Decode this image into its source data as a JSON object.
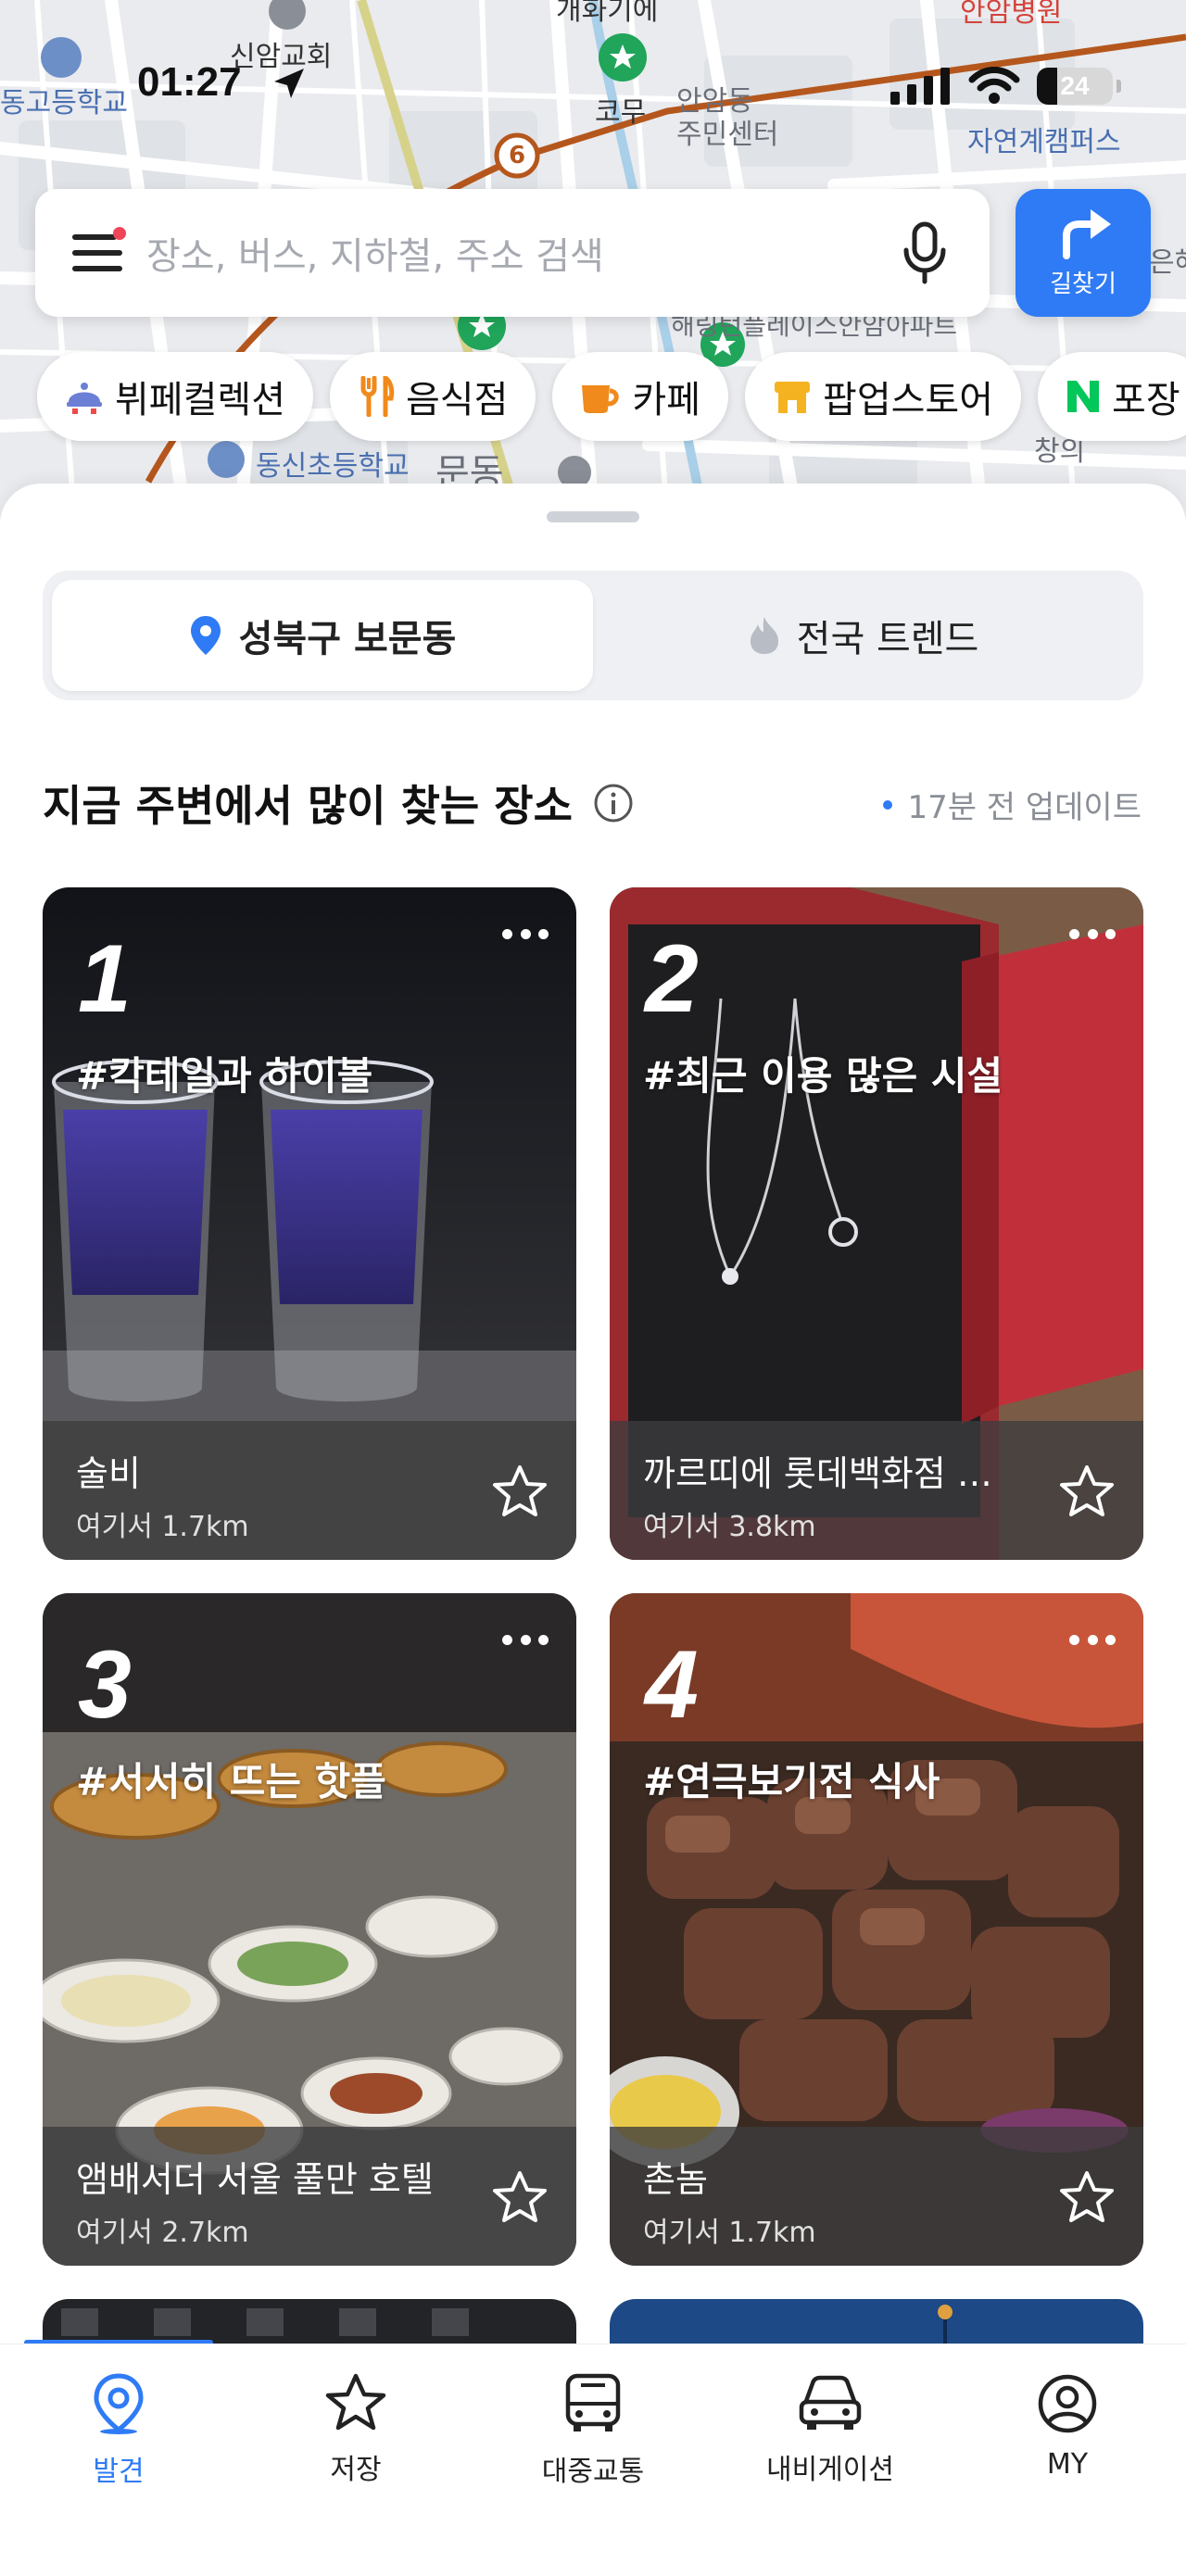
{
  "status_bar": {
    "time": "01:27",
    "battery": "24"
  },
  "map": {
    "labels": {
      "church": "신암교회",
      "school_left": "동고등학교",
      "station_top": "개화기에",
      "komu": "코무",
      "anam_center": "안암동\n주민센터",
      "hospital": "안암병원",
      "campus": "자연계캠퍼스",
      "apartment": "해링턴플레이스안암아파트",
      "elem_school": "동신초등학교",
      "bomun": "문동",
      "changui": "창의",
      "eun": "은해"
    },
    "line_number": "6"
  },
  "search": {
    "placeholder": "장소, 버스, 지하철, 주소 검색",
    "route_label": "길찾기"
  },
  "chips": [
    {
      "label": "뷔페컬렉션",
      "icon": "buffet-icon"
    },
    {
      "label": "음식점",
      "icon": "fork-knife-icon"
    },
    {
      "label": "카페",
      "icon": "cup-icon"
    },
    {
      "label": "팝업스토어",
      "icon": "store-icon"
    },
    {
      "label": "포장",
      "icon": "naver-icon"
    }
  ],
  "segment": {
    "local": "성북구 보문동",
    "national": "전국 트렌드"
  },
  "section": {
    "title": "지금 주변에서 많이 찾는 장소",
    "updated": "17분 전 업데이트"
  },
  "cards": [
    {
      "rank": "1",
      "tag": "#칵테일과 하이볼",
      "name": "술비",
      "distance": "여기서 1.7km"
    },
    {
      "rank": "2",
      "tag": "#최근 이용 많은 시설",
      "name": "까르띠에 롯데백화점 에비뉴엘 본점",
      "distance": "여기서 3.8km"
    },
    {
      "rank": "3",
      "tag": "#서서히 뜨는 핫플",
      "name": "앰배서더 서울 풀만 호텔",
      "distance": "여기서 2.7km"
    },
    {
      "rank": "4",
      "tag": "#연극보기전 식사",
      "name": "촌놈",
      "distance": "여기서 1.7km"
    }
  ],
  "nav": [
    {
      "label": "발견",
      "icon": "location-pin-icon"
    },
    {
      "label": "저장",
      "icon": "star-icon"
    },
    {
      "label": "대중교통",
      "icon": "bus-icon"
    },
    {
      "label": "내비게이션",
      "icon": "car-icon"
    },
    {
      "label": "MY",
      "icon": "profile-icon"
    }
  ],
  "colors": {
    "accent": "#2f7bf5",
    "line6": "#b5571d"
  }
}
